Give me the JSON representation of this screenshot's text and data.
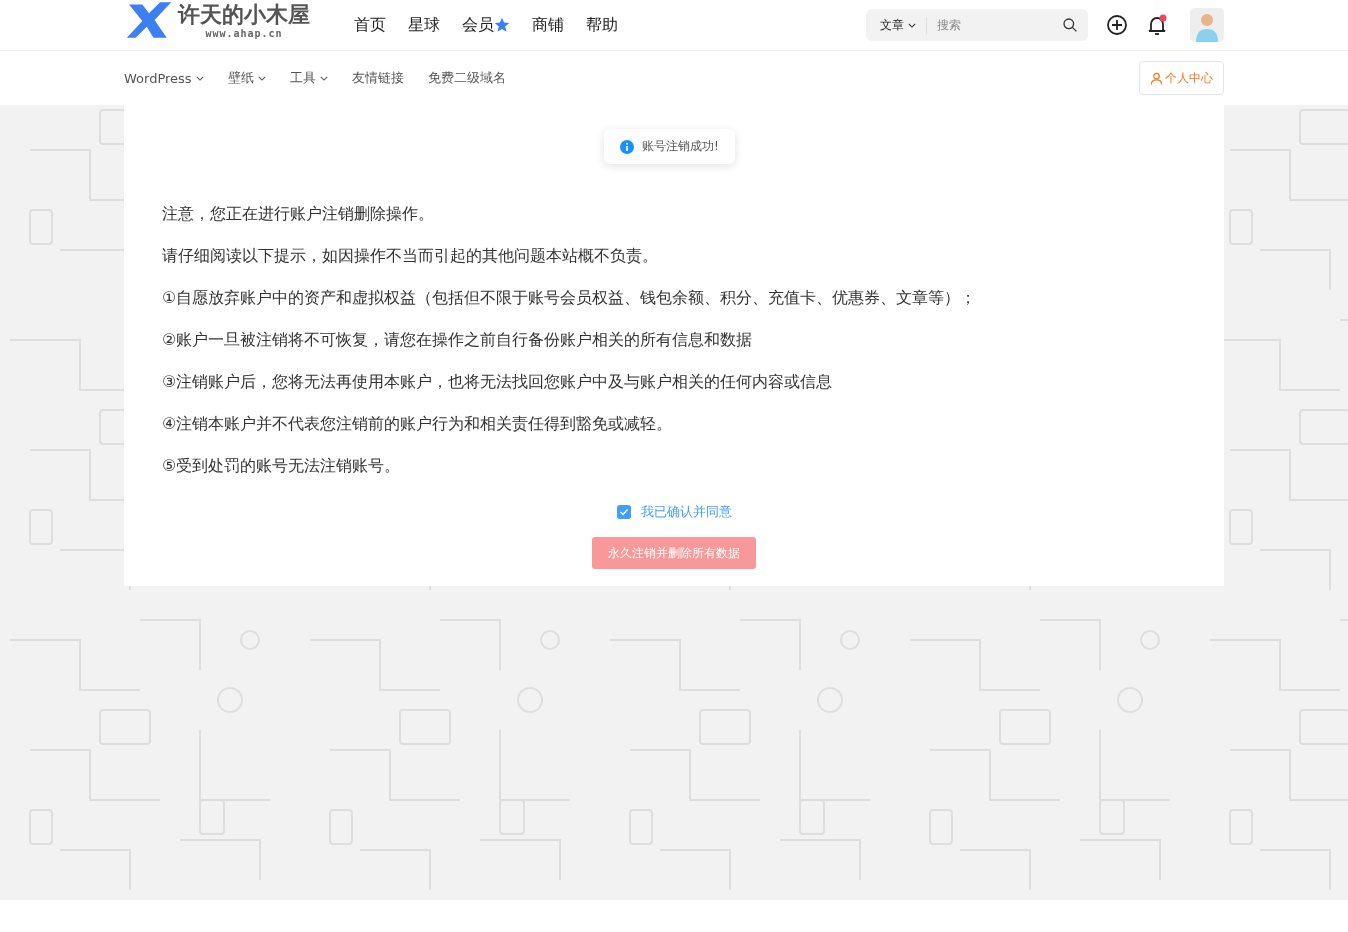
{
  "logo": {
    "name": "许天的小木屋",
    "url": "www.ahap.cn"
  },
  "main_nav": [
    {
      "label": "首页",
      "starred": false
    },
    {
      "label": "星球",
      "starred": false
    },
    {
      "label": "会员",
      "starred": true
    },
    {
      "label": "商铺",
      "starred": false
    },
    {
      "label": "帮助",
      "starred": false
    }
  ],
  "search": {
    "scope": "文章",
    "placeholder": "搜索"
  },
  "notifications": {
    "unread": true
  },
  "sub_nav": [
    {
      "label": "WordPress",
      "dropdown": true
    },
    {
      "label": "壁纸",
      "dropdown": true
    },
    {
      "label": "工具",
      "dropdown": true
    },
    {
      "label": "友情链接",
      "dropdown": false
    },
    {
      "label": "免费二级域名",
      "dropdown": false
    }
  ],
  "user_center_button": "个人中心",
  "toast": {
    "message": "账号注销成功!"
  },
  "card": {
    "paragraphs": [
      "注意，您正在进行账户注销删除操作。",
      "请仔细阅读以下提示，如因操作不当而引起的其他问题本站概不负责。",
      "①自愿放弃账户中的资产和虚拟权益（包括但不限于账号会员权益、钱包余额、积分、充值卡、优惠券、文章等）；",
      "②账户一旦被注销将不可恢复，请您在操作之前自行备份账户相关的所有信息和数据",
      "③注销账户后，您将无法再使用本账户，也将无法找回您账户中及与账户相关的任何内容或信息",
      "④注销本账户并不代表您注销前的账户行为和相关责任得到豁免或减轻。",
      "⑤受到处罚的账号无法注销账号。"
    ],
    "agree": {
      "label": "我已确认并同意",
      "checked": true
    },
    "delete_button": {
      "label": "永久注销并删除所有数据",
      "disabled": true
    }
  }
}
